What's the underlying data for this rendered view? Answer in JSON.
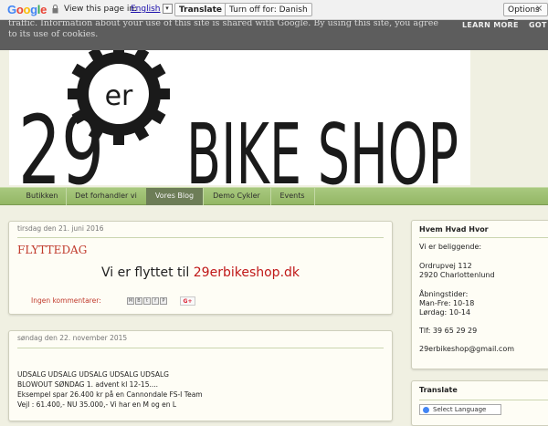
{
  "translate_bar": {
    "google_letters": [
      {
        "ch": "G",
        "color": "#4285f4"
      },
      {
        "ch": "o",
        "color": "#ea4335"
      },
      {
        "ch": "o",
        "color": "#fbbc05"
      },
      {
        "ch": "g",
        "color": "#4285f4"
      },
      {
        "ch": "l",
        "color": "#34a853"
      },
      {
        "ch": "e",
        "color": "#ea4335"
      }
    ],
    "view_text": "View this page in:",
    "language": "English",
    "translate_label": "Translate",
    "turn_off_label": "Turn off for: Danish",
    "options_label": "Options ▼",
    "close_glyph": "×"
  },
  "cookie": {
    "text": "traffic. Information about your use of this site is shared with Google. By using this site, you agree to its use of cookies.",
    "learn_more": "LEARN MORE",
    "got_it": "GOT"
  },
  "banner": {
    "number": "29",
    "superscript": "er",
    "shop": "BIKE SHOP"
  },
  "nav": {
    "items": [
      {
        "label": "Butikken"
      },
      {
        "label": "Det forhandler vi"
      },
      {
        "label": "Vores Blog"
      },
      {
        "label": "Demo Cykler"
      },
      {
        "label": "Events"
      }
    ],
    "active_index": 2
  },
  "posts": [
    {
      "date": "tirsdag den 21. juni 2016",
      "title": "FLYTTEDAG",
      "message_prefix": "Vi er flyttet til ",
      "message_link": "29erbikeshop.dk",
      "comments": "Ingen kommentarer:",
      "share_icons": [
        "M",
        "B",
        "t",
        "f",
        "P"
      ],
      "gplus": "G+"
    },
    {
      "date": "søndag den 22. november 2015",
      "body_lines": [
        "UDSALG UDSALG UDSALG UDSALG UDSALG",
        "BLOWOUT SØNDAG 1. advent kl 12-15....",
        "Eksempel spar 26.400 kr på en Cannondale FS-I Team",
        "Vejl : 61.400,- NU 35.000,- Vi har en M og en L"
      ]
    }
  ],
  "sidebar": {
    "hvem": {
      "title": "Hvem Hvad Hvor",
      "lines": [
        "Vi er beliggende:",
        "",
        "Ordrupvej 112",
        "2920 Charlottenlund",
        "",
        "Åbningstider:",
        "Man-Fre: 10-18",
        "Lørdag: 10-14",
        "",
        "Tlf: 39 65 29 29",
        "",
        "29erbikeshop@gmail.com"
      ]
    },
    "translate": {
      "title": "Translate",
      "select_label": "Select Language"
    }
  },
  "colors": {
    "accent_red": "#c0392b",
    "nav_green": "#a9c97f",
    "nav_active": "#6d7d57",
    "page_bg": "#f0f0e2"
  }
}
